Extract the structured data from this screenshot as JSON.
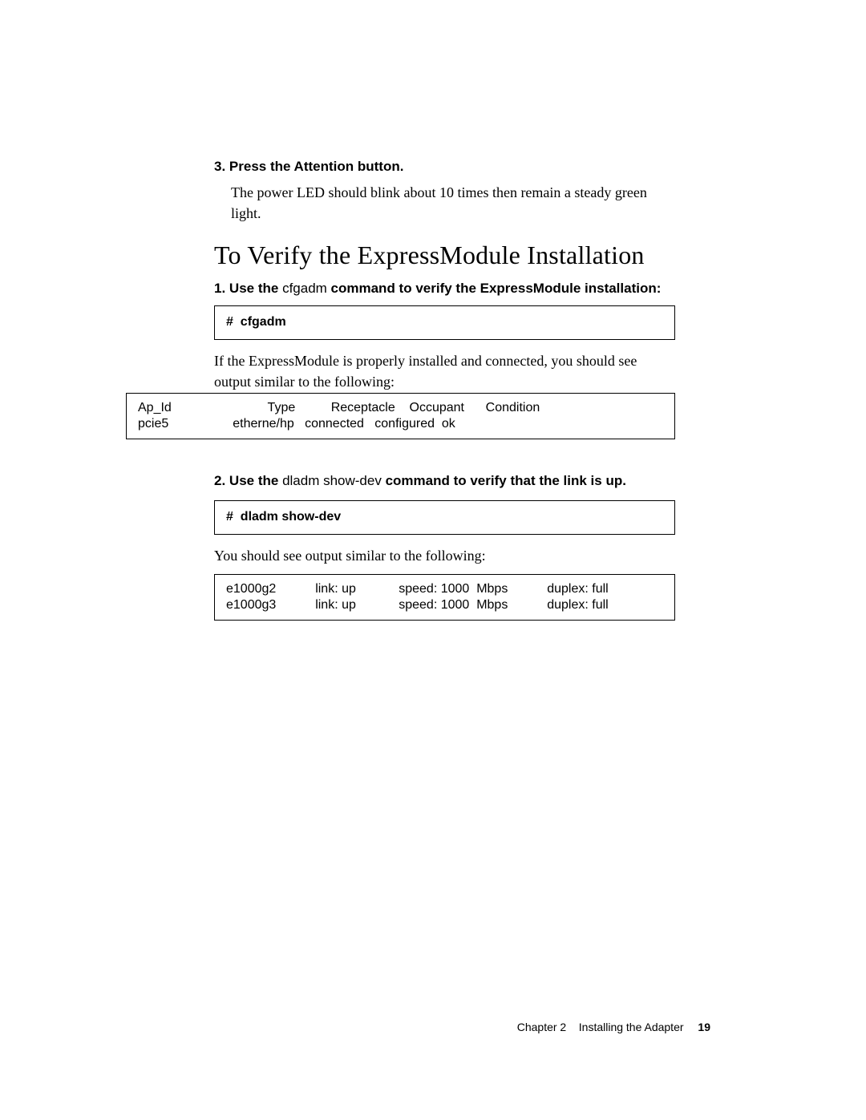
{
  "step3": {
    "num": "3.",
    "text": "Press the Attention button.",
    "desc": "The power LED should blink about 10 times then remain a steady green light."
  },
  "section_heading": "To Verify the ExpressModule Installation",
  "verify_step1": {
    "num": "1.",
    "prefix": "Use the ",
    "cmd": "cfgadm",
    "suffix": " command to verify the ExpressModule installation:"
  },
  "codebox1": "#  cfgadm",
  "verify_step1_followup": "If the ExpressModule is properly installed and connected, you should see output similar to the following:",
  "output1": {
    "header": "Ap_Id                           Type          Receptacle    Occupant      Condition",
    "row": "pcie5                  etherne/hp   connected   configured  ok"
  },
  "verify_step2": {
    "num": "2.",
    "prefix": "Use the ",
    "cmd": "dladm show-dev",
    "suffix": " command to verify that the link is up."
  },
  "codebox2": "#  dladm show-dev",
  "verify_step2_followup": "You should see output similar to the following:",
  "output2": {
    "row1": "e1000g2           link: up            speed: 1000  Mbps           duplex: full",
    "row2": "e1000g3           link: up            speed: 1000  Mbps           duplex: full"
  },
  "footer": {
    "chapter": "Chapter 2",
    "title": "Installing the Adapter",
    "page": "19"
  }
}
